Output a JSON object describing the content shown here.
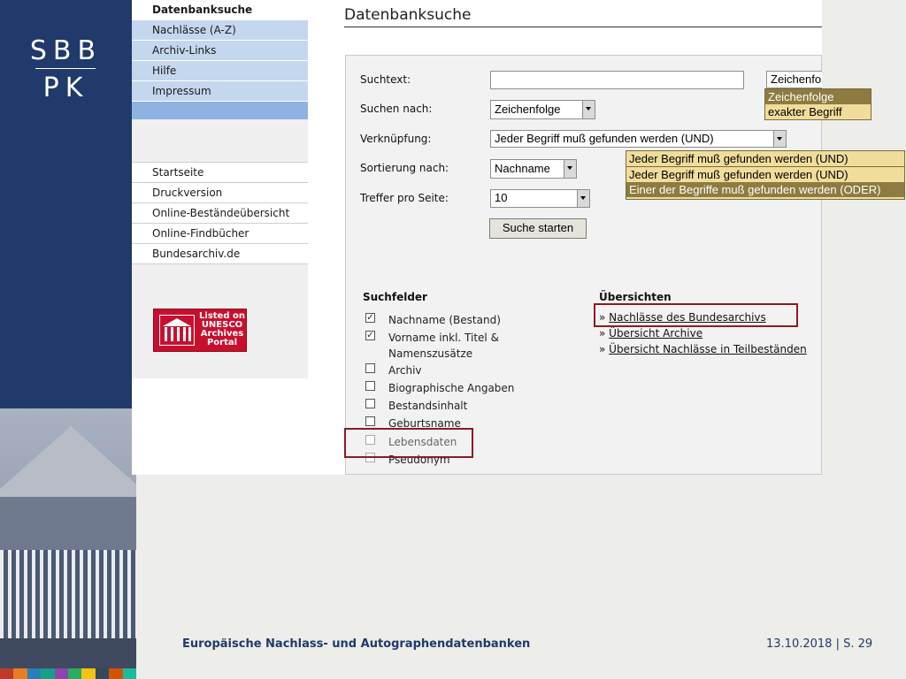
{
  "brand": {
    "logo_top": "SBB",
    "logo_bottom": "PK"
  },
  "nav": {
    "primary": [
      "Datenbanksuche",
      "Nachlässe (A-Z)",
      "Archiv-Links",
      "Hilfe",
      "Impressum"
    ],
    "secondary": [
      "Startseite",
      "Druckversion",
      "Online-Beständeübersicht",
      "Online-Findbücher",
      "Bundesarchiv.de"
    ],
    "unesco_text": "Listed on\nUNESCO\nArchives\nPortal"
  },
  "main": {
    "title": "Datenbanksuche"
  },
  "form": {
    "suchtext": {
      "label": "Suchtext:",
      "value": ""
    },
    "suchtext_mode": "Zeichenfolge",
    "suchtext_mode_options": [
      "Zeichenfolge",
      "exakter Begriff"
    ],
    "suchen_nach": {
      "label": "Suchen nach:",
      "value": "Zeichenfolge"
    },
    "verknuepfung": {
      "label": "Verknüpfung:",
      "value": "Jeder Begriff muß gefunden werden (UND)",
      "options": [
        "Jeder Begriff muß gefunden werden (UND)",
        "Einer der Begriffe muß gefunden werden (ODER)"
      ]
    },
    "sortierung": {
      "label": "Sortierung nach:",
      "value": "Nachname"
    },
    "treffer": {
      "label": "Treffer pro Seite:",
      "value": "10"
    },
    "submit_label": "Suche starten"
  },
  "suchfelder": {
    "heading": "Suchfelder",
    "items": [
      {
        "label": "Nachname (Bestand)",
        "checked": true
      },
      {
        "label": "Vorname inkl. Titel &",
        "checked": true
      },
      {
        "label": "Namenszusätze",
        "checked": null
      },
      {
        "label": "Archiv",
        "checked": false
      },
      {
        "label": "Biographische Angaben",
        "checked": false
      },
      {
        "label": "Bestandsinhalt",
        "checked": false
      },
      {
        "label": "Geburtsname",
        "checked": false
      },
      {
        "label": "Lebensdaten",
        "checked": false
      },
      {
        "label": "Pseudonym",
        "checked": false
      }
    ]
  },
  "uebersichten": {
    "heading": "Übersichten",
    "links": [
      "Nachlässe des Bundesarchivs",
      "Übersicht Archive",
      "Übersicht Nachlässe in Teilbeständen"
    ]
  },
  "footer": {
    "title": "Europäische Nachlass- und Autographendatenbanken",
    "date": "13.10.2018",
    "page": "S. 29"
  },
  "colors": {
    "brand_blue": "#1f3a6b",
    "highlight_red": "#8c1b22",
    "dropdown_yellow": "#f1dd9b"
  }
}
